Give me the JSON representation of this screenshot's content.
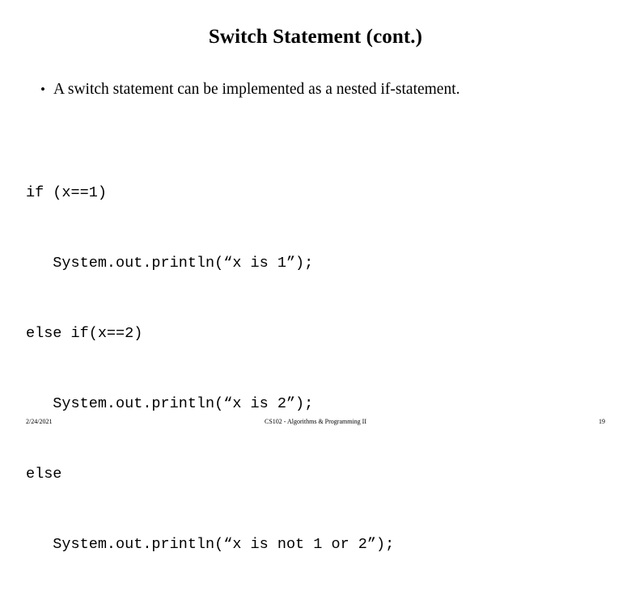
{
  "slide": {
    "title": "Switch Statement (cont.)",
    "bullets": [
      {
        "marker": "•",
        "text": "A switch statement can be implemented as a nested if-statement."
      }
    ],
    "code_lines": [
      "if (x==1)",
      "   System.out.println(“x is 1”);",
      "else if(x==2)",
      "   System.out.println(“x is 2”);",
      "else",
      "   System.out.println(“x is not 1 or 2”);"
    ],
    "footer": {
      "date": "2/24/2021",
      "center": "CS102 - Algorithms & Programming II",
      "page": "19"
    }
  }
}
